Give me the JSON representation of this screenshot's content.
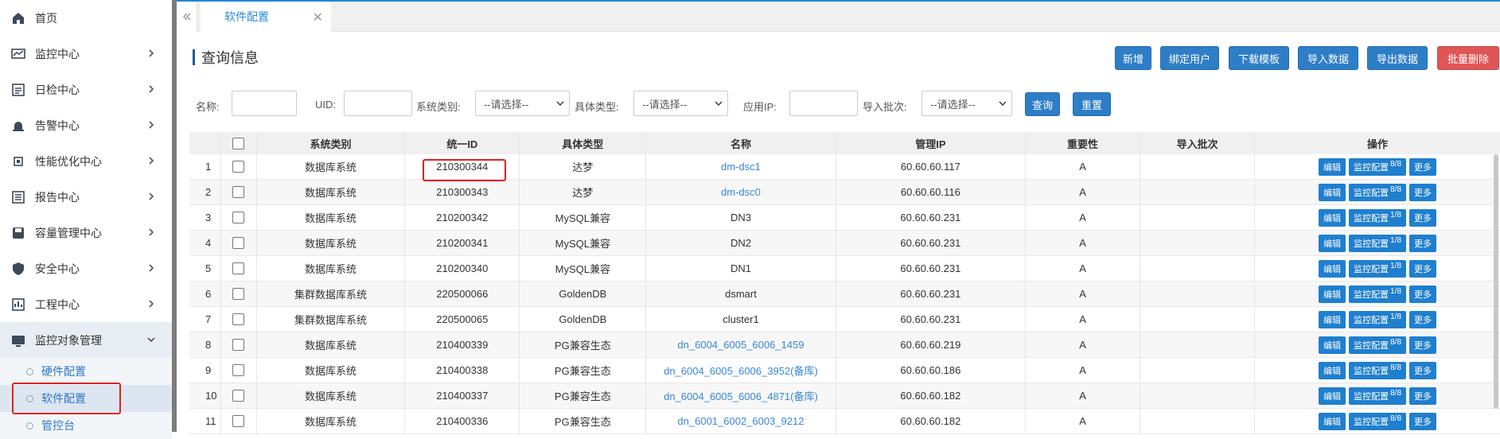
{
  "sidebar": {
    "items": [
      {
        "label": "首页",
        "icon": "home-icon"
      },
      {
        "label": "监控中心",
        "icon": "monitor-chart-icon"
      },
      {
        "label": "日检中心",
        "icon": "calendar-check-icon"
      },
      {
        "label": "告警中心",
        "icon": "alarm-icon"
      },
      {
        "label": "性能优化中心",
        "icon": "cpu-icon"
      },
      {
        "label": "报告中心",
        "icon": "report-icon"
      },
      {
        "label": "容量管理中心",
        "icon": "disk-icon"
      },
      {
        "label": "安全中心",
        "icon": "shield-icon"
      },
      {
        "label": "工程中心",
        "icon": "project-icon"
      },
      {
        "label": "监控对象管理",
        "icon": "object-manage-icon"
      }
    ],
    "sub_items": [
      {
        "label": "硬件配置"
      },
      {
        "label": "软件配置"
      },
      {
        "label": "管控台"
      }
    ]
  },
  "tabs": {
    "active_label": "软件配置",
    "close_glyph": "✕"
  },
  "page": {
    "title": "查询信息"
  },
  "toolbar": {
    "buttons": [
      "新增",
      "绑定用户",
      "下载模板",
      "导入数据",
      "导出数据",
      "批量删除"
    ]
  },
  "filters": {
    "name_label": "名称:",
    "uid_label": "UID:",
    "category_label": "系统类别:",
    "category_value": "--请选择--",
    "type_label": "具体类型:",
    "type_value": "--请选择--",
    "ip_label": "应用IP:",
    "batch_label": "导入批次:",
    "batch_value": "--请选择--",
    "query_button": "查询",
    "reset_button": "重置"
  },
  "table": {
    "headers": [
      "系统类别",
      "统一ID",
      "具体类型",
      "名称",
      "管理IP",
      "重要性",
      "导入批次",
      "操作"
    ],
    "op_labels": {
      "edit": "编辑",
      "monitor": "监控配置",
      "more": "更多"
    },
    "rows": [
      {
        "idx": "1",
        "cat": "数据库系统",
        "uid": "210300344",
        "typ": "达梦",
        "name": "dm-dsc1",
        "link": true,
        "ip": "60.60.60.117",
        "imp": "A",
        "batch": "",
        "mon": "8/8"
      },
      {
        "idx": "2",
        "cat": "数据库系统",
        "uid": "210300343",
        "typ": "达梦",
        "name": "dm-dsc0",
        "link": true,
        "ip": "60.60.60.116",
        "imp": "A",
        "batch": "",
        "mon": "8/8"
      },
      {
        "idx": "3",
        "cat": "数据库系统",
        "uid": "210200342",
        "typ": "MySQL兼容",
        "name": "DN3",
        "link": false,
        "ip": "60.60.60.231",
        "imp": "A",
        "batch": "",
        "mon": "1/8"
      },
      {
        "idx": "4",
        "cat": "数据库系统",
        "uid": "210200341",
        "typ": "MySQL兼容",
        "name": "DN2",
        "link": false,
        "ip": "60.60.60.231",
        "imp": "A",
        "batch": "",
        "mon": "1/8"
      },
      {
        "idx": "5",
        "cat": "数据库系统",
        "uid": "210200340",
        "typ": "MySQL兼容",
        "name": "DN1",
        "link": false,
        "ip": "60.60.60.231",
        "imp": "A",
        "batch": "",
        "mon": "1/8"
      },
      {
        "idx": "6",
        "cat": "集群数据库系统",
        "uid": "220500066",
        "typ": "GoldenDB",
        "name": "dsmart",
        "link": false,
        "ip": "60.60.60.231",
        "imp": "A",
        "batch": "",
        "mon": "1/8"
      },
      {
        "idx": "7",
        "cat": "集群数据库系统",
        "uid": "220500065",
        "typ": "GoldenDB",
        "name": "cluster1",
        "link": false,
        "ip": "60.60.60.231",
        "imp": "A",
        "batch": "",
        "mon": "1/8"
      },
      {
        "idx": "8",
        "cat": "数据库系统",
        "uid": "210400339",
        "typ": "PG兼容生态",
        "name": "dn_6004_6005_6006_1459",
        "link": true,
        "ip": "60.60.60.219",
        "imp": "A",
        "batch": "",
        "mon": "8/8"
      },
      {
        "idx": "9",
        "cat": "数据库系统",
        "uid": "210400338",
        "typ": "PG兼容生态",
        "name": "dn_6004_6005_6006_3952(备库)",
        "link": true,
        "ip": "60.60.60.186",
        "imp": "A",
        "batch": "",
        "mon": "8/8"
      },
      {
        "idx": "10",
        "cat": "数据库系统",
        "uid": "210400337",
        "typ": "PG兼容生态",
        "name": "dn_6004_6005_6006_4871(备库)",
        "link": true,
        "ip": "60.60.60.182",
        "imp": "A",
        "batch": "",
        "mon": "8/8"
      },
      {
        "idx": "11",
        "cat": "数据库系统",
        "uid": "210400336",
        "typ": "PG兼容生态",
        "name": "dn_6001_6002_6003_9212",
        "link": true,
        "ip": "60.60.60.182",
        "imp": "A",
        "batch": "",
        "mon": "8/8"
      }
    ]
  },
  "colors": {
    "accent": "#2e7ec7",
    "danger": "#e05555",
    "highlight_box": "#e02020",
    "link": "#3a86d8"
  }
}
